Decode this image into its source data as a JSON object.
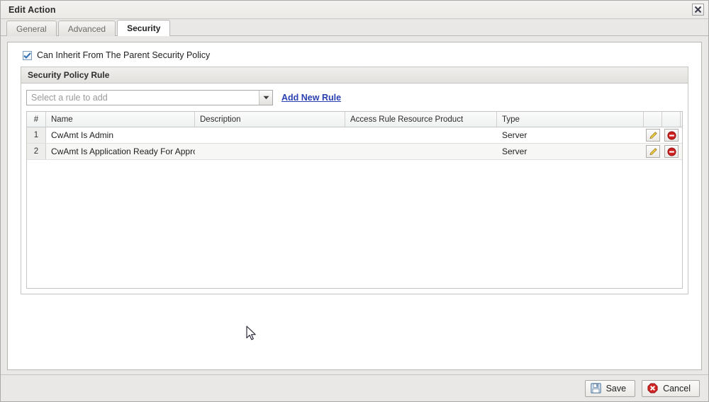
{
  "window": {
    "title": "Edit Action",
    "close_icon": "close-x-icon"
  },
  "tabs": [
    {
      "label": "General",
      "active": false
    },
    {
      "label": "Advanced",
      "active": false
    },
    {
      "label": "Security",
      "active": true
    }
  ],
  "inherit": {
    "label": "Can Inherit From The Parent Security Policy",
    "checked": true
  },
  "group": {
    "title": "Security Policy Rule"
  },
  "toolbar": {
    "select_value": "Select a rule to add",
    "select_placeholder": "Select a rule to add",
    "dropdown_icon": "chevron-down-icon",
    "add_link": "Add New Rule"
  },
  "grid": {
    "columns": [
      "#",
      "Name",
      "Description",
      "Access Rule Resource Product",
      "Type",
      "",
      ""
    ],
    "rows": [
      {
        "num": "1",
        "name": "CwAmt Is Admin",
        "description": "",
        "product": "",
        "type": "Server",
        "edit_icon": "pencil-edit-icon",
        "delete_icon": "delete-circle-icon"
      },
      {
        "num": "2",
        "name": "CwAmt Is Application Ready For Appro...",
        "description": "",
        "product": "",
        "type": "Server",
        "edit_icon": "pencil-edit-icon",
        "delete_icon": "delete-circle-icon"
      }
    ]
  },
  "footer": {
    "save_label": "Save",
    "save_icon": "floppy-save-icon",
    "cancel_label": "Cancel",
    "cancel_icon": "cancel-octagon-icon"
  },
  "colors": {
    "link": "#2a3fb0",
    "accent_delete": "#cc2222",
    "accent_edit": "#e8b83a",
    "titlebar": "#eceae7",
    "panel": "#ffffff"
  }
}
